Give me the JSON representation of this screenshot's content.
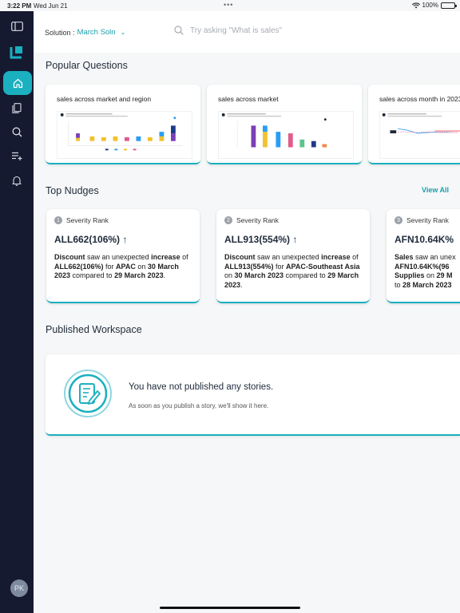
{
  "status": {
    "time": "3:22 PM",
    "date": "Wed Jun 21",
    "battery": "100%"
  },
  "sidebar": {
    "items": [
      "panel-toggle",
      "logo",
      "home",
      "bookmarks",
      "search",
      "playlist-add",
      "notifications"
    ],
    "active": "home",
    "avatar_initials": "PK"
  },
  "topbar": {
    "solution_label": "Solution :",
    "solution_value": "March Soln",
    "search_placeholder": "Try asking \"What is sales\""
  },
  "popular": {
    "title": "Popular Questions",
    "cards": [
      {
        "title": "sales across market and region"
      },
      {
        "title": "sales across market"
      },
      {
        "title": "sales across month in 2023"
      }
    ]
  },
  "nudges": {
    "title": "Top Nudges",
    "view_all": "View All",
    "cards": [
      {
        "rank": "1",
        "rank_label": "Severity Rank",
        "metric": "ALL662(106%) ↑",
        "d1": "Discount",
        "d2": " saw an unexpected ",
        "d3": "increase",
        "d4": " of ",
        "d5": "ALL662(106%)",
        "d6": " for ",
        "d7": "APAC",
        "d8": " on ",
        "d9": "30 March 2023",
        "d10": " compared to ",
        "d11": "29 March 2023",
        "d12": "."
      },
      {
        "rank": "2",
        "rank_label": "Severity Rank",
        "metric": "ALL913(554%) ↑",
        "d1": "Discount",
        "d2": " saw an unexpected ",
        "d3": "increase",
        "d4": " of ",
        "d5": "ALL913(554%)",
        "d6": " for ",
        "d7": "APAC-Southeast Asia",
        "d8": " on ",
        "d9": "30 March 2023",
        "d10": " compared to ",
        "d11": "29 March 2023",
        "d12": "."
      },
      {
        "rank": "3",
        "rank_label": "Severity Rank",
        "metric": "AFN10.64K%",
        "d1": "Sales",
        "d2": " saw an unex",
        "d3": "",
        "d4": "",
        "d5": "AFN10.64K%(96",
        "d6": "",
        "d7": "Supplies",
        "d8": " on ",
        "d9": "29 M",
        "d10": "to ",
        "d11": "28 March 2023",
        "d12": ""
      }
    ]
  },
  "published": {
    "title": "Published Workspace",
    "empty_title": "You have not published any stories.",
    "empty_sub": "As soon as you publish a story, we'll show it here."
  },
  "colors": {
    "accent": "#1ab0bf",
    "sidebar": "#151a30",
    "page_bg": "#f6f7f8"
  }
}
